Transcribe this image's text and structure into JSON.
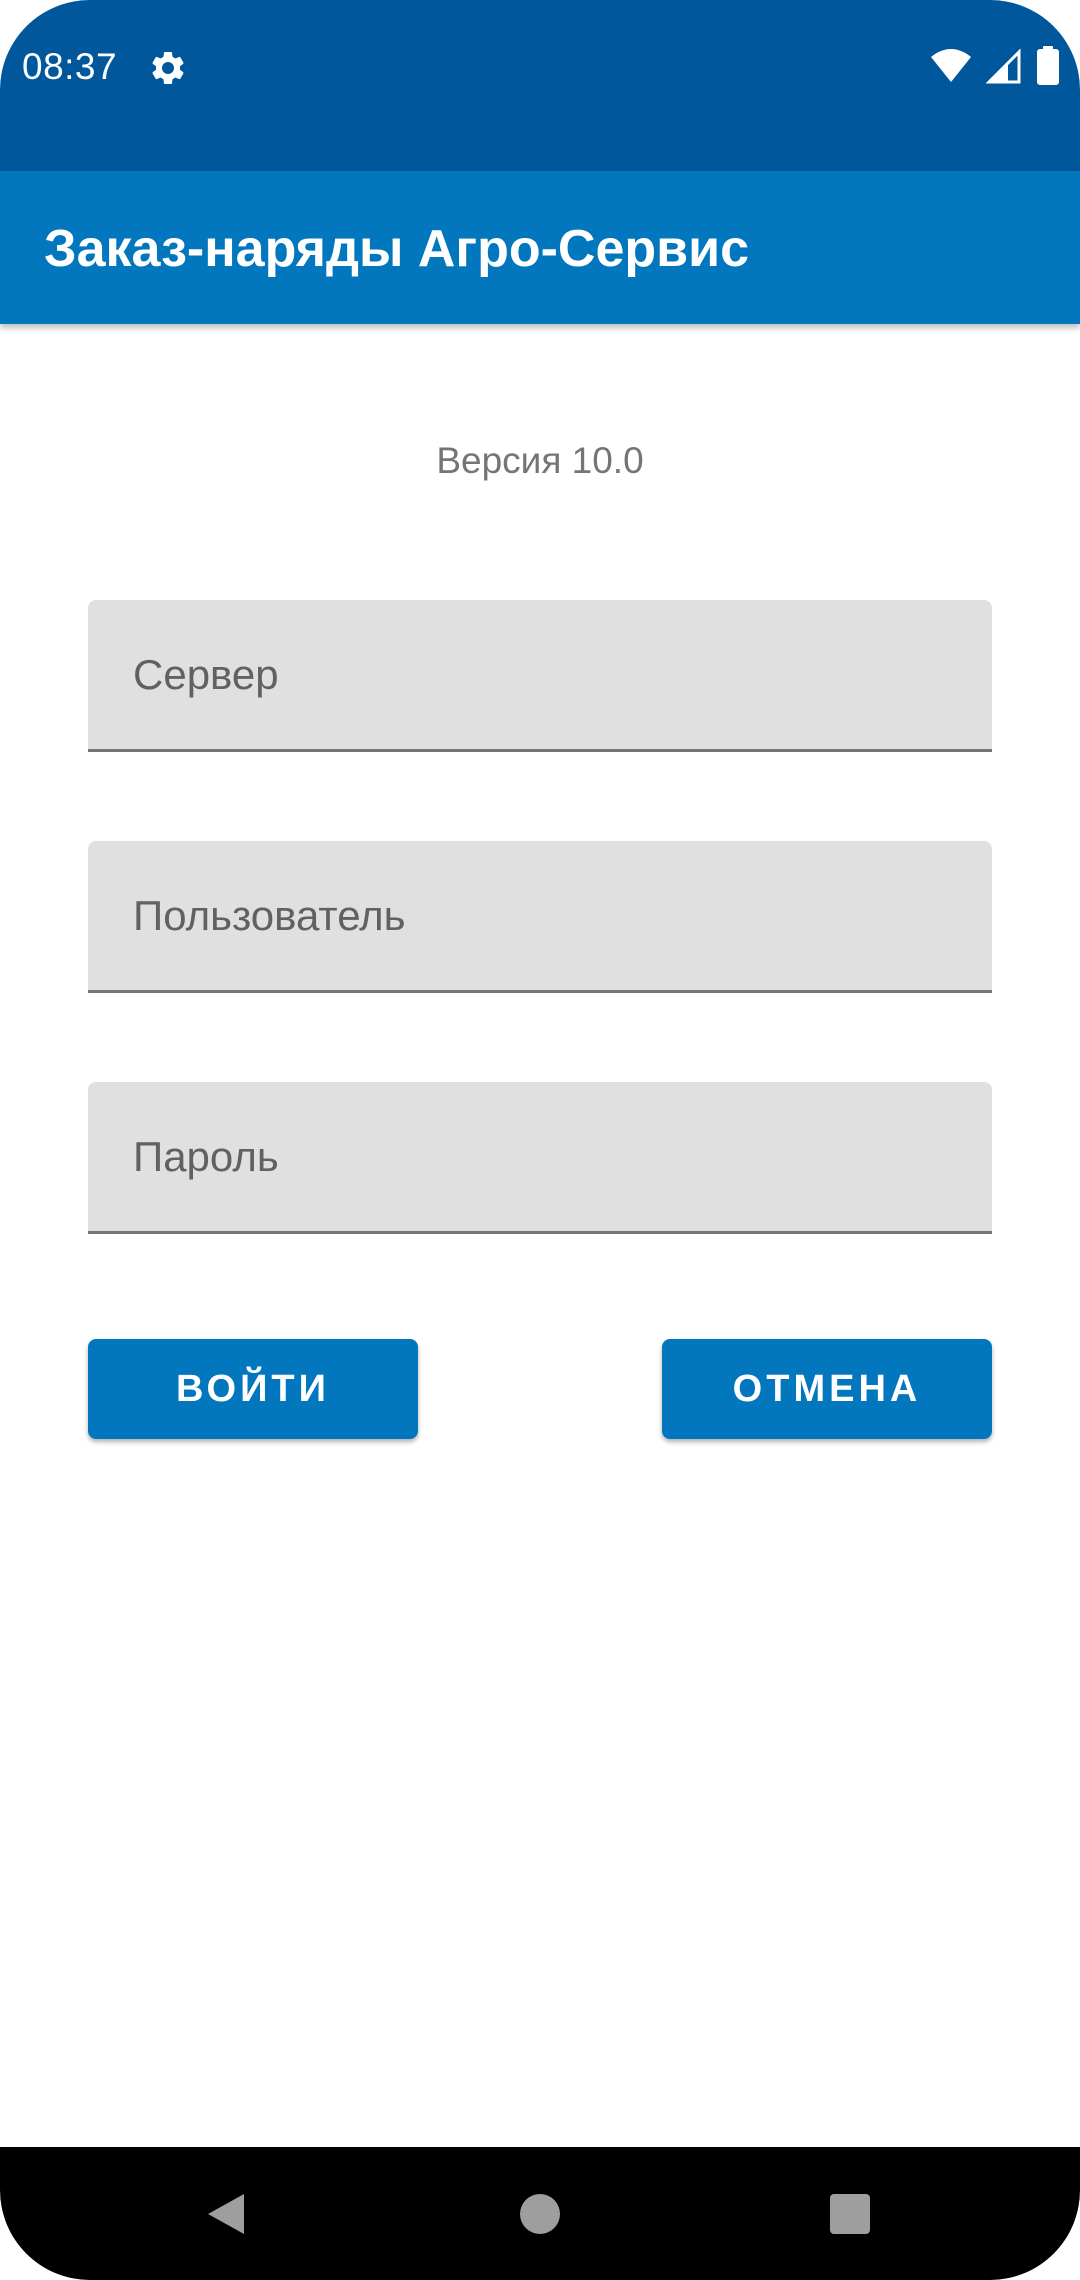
{
  "status_bar": {
    "time": "08:37",
    "icons": [
      "gear-icon",
      "wifi-icon",
      "signal-icon",
      "battery-icon"
    ],
    "background_color": "#01579b"
  },
  "app_bar": {
    "title": "Заказ-наряды Агро-Сервис",
    "background_color": "#0277bd"
  },
  "login_form": {
    "version_text": "Версия 10.0",
    "server_field": {
      "placeholder": "Сервер",
      "value": ""
    },
    "user_field": {
      "placeholder": "Пользователь",
      "value": ""
    },
    "password_field": {
      "placeholder": "Пароль",
      "value": ""
    },
    "login_button_label": "ВОЙТИ",
    "cancel_button_label": "ОТМЕНА",
    "accent_color": "#0277bd"
  },
  "navigation_bar": {
    "icons": [
      "back-icon",
      "home-icon",
      "recent-apps-icon"
    ]
  }
}
